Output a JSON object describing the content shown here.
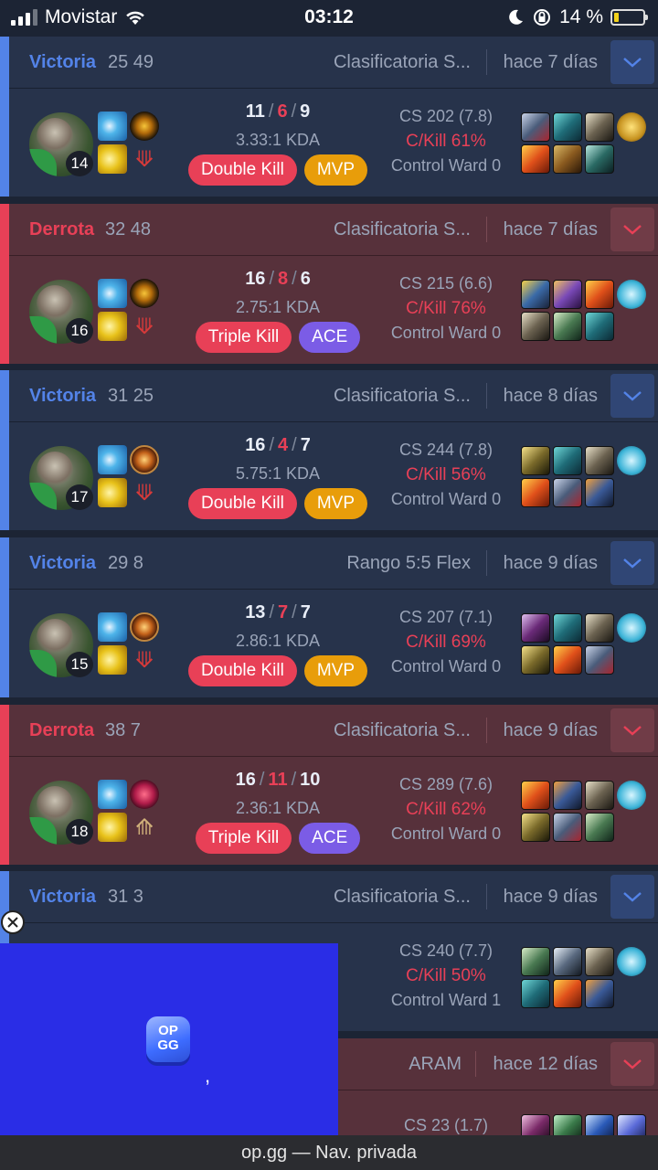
{
  "status_bar": {
    "carrier": "Movistar",
    "time": "03:12",
    "battery": "14 %",
    "battery_level": 0.14
  },
  "matches": [
    {
      "result": "Victoria",
      "kp": "25 49",
      "queue": "Clasificatoria S...",
      "ago": "hace 7 días",
      "level": "14",
      "kills": "11",
      "deaths": "6",
      "assists": "9",
      "ratio": "3.33:1 KDA",
      "badges": [
        "Double Kill",
        "MVP"
      ],
      "cs": "CS 202 (7.8)",
      "ckill": "C/Kill 61%",
      "ward": "Control Ward 0"
    },
    {
      "result": "Derrota",
      "kp": "32 48",
      "queue": "Clasificatoria S...",
      "ago": "hace 7 días",
      "level": "16",
      "kills": "16",
      "deaths": "8",
      "assists": "6",
      "ratio": "2.75:1 KDA",
      "badges": [
        "Triple Kill",
        "ACE"
      ],
      "cs": "CS 215 (6.6)",
      "ckill": "C/Kill 76%",
      "ward": "Control Ward 0"
    },
    {
      "result": "Victoria",
      "kp": "31 25",
      "queue": "Clasificatoria S...",
      "ago": "hace 8 días",
      "level": "17",
      "kills": "16",
      "deaths": "4",
      "assists": "7",
      "ratio": "5.75:1 KDA",
      "badges": [
        "Double Kill",
        "MVP"
      ],
      "cs": "CS 244 (7.8)",
      "ckill": "C/Kill 56%",
      "ward": "Control Ward 0"
    },
    {
      "result": "Victoria",
      "kp": "29 8",
      "queue": "Rango 5:5 Flex",
      "ago": "hace 9 días",
      "level": "15",
      "kills": "13",
      "deaths": "7",
      "assists": "7",
      "ratio": "2.86:1 KDA",
      "badges": [
        "Double Kill",
        "MVP"
      ],
      "cs": "CS 207 (7.1)",
      "ckill": "C/Kill 69%",
      "ward": "Control Ward 0"
    },
    {
      "result": "Derrota",
      "kp": "38 7",
      "queue": "Clasificatoria S...",
      "ago": "hace 9 días",
      "level": "18",
      "kills": "16",
      "deaths": "11",
      "assists": "10",
      "ratio": "2.36:1 KDA",
      "badges": [
        "Triple Kill",
        "ACE"
      ],
      "cs": "CS 289 (7.6)",
      "ckill": "C/Kill 62%",
      "ward": "Control Ward 0"
    },
    {
      "result": "Victoria",
      "kp": "31 3",
      "queue": "Clasificatoria S...",
      "ago": "hace 9 días",
      "cs": "CS 240 (7.7)",
      "ckill": "C/Kill 50%",
      "ward": "Control Ward 1"
    },
    {
      "queue": "ARAM",
      "ago": "hace 12 días",
      "cs": "CS 23 (1.7)"
    }
  ],
  "ad": {
    "logo_text": "OP GG",
    "caption": ","
  },
  "browser": {
    "url_text": "op.gg — Nav. privada"
  },
  "colors": {
    "win": "#5383e8",
    "loss": "#e84057",
    "mvp": "#e89d0a",
    "ace": "#7b5ce6",
    "ad_bg": "#2a2de6"
  }
}
